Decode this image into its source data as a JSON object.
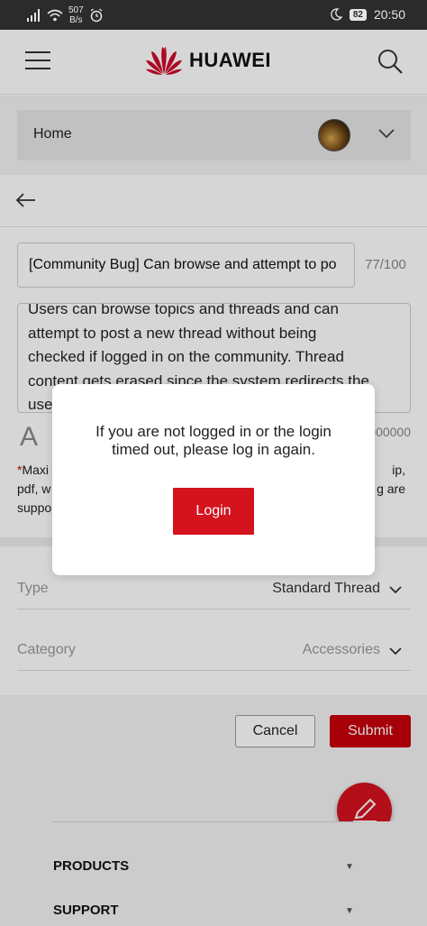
{
  "status_bar": {
    "net_speed_value": "507",
    "net_speed_unit": "B/s",
    "battery": "82",
    "time": "20:50",
    "icons": [
      "signal-icon",
      "wifi-icon",
      "alarm-icon",
      "moon-icon",
      "battery-icon"
    ]
  },
  "header": {
    "brand": "HUAWEI",
    "icons": [
      "hamburger-menu-icon",
      "huawei-logo",
      "search-icon"
    ]
  },
  "breadcrumb": {
    "label": "Home"
  },
  "post": {
    "title_value": "[Community Bug] Can browse and attempt to po",
    "title_count": "77/100",
    "content_lines": [
      "Users can browse topics and threads and can",
      "attempt to post a new thread without being",
      "checked if logged in on the community. Thread",
      "content gets erased since the system redirects the",
      "use"
    ],
    "editor_icon_letter": "A",
    "char_count": "000000",
    "note_lines": [
      "Maxi",
      "pdf, w",
      "suppo"
    ],
    "note_right_lines": [
      "ip,",
      "g are",
      ""
    ]
  },
  "fields": {
    "type_label": "Type",
    "type_value": "Standard Thread",
    "category_label": "Category",
    "category_value": "Accessories"
  },
  "actions": {
    "cancel_label": "Cancel",
    "submit_label": "Submit",
    "fab_icon": "pencil-icon"
  },
  "footer": {
    "items": [
      "PRODUCTS",
      "SUPPORT"
    ]
  },
  "dialog": {
    "message": "If you are not logged in or the login timed out, please log in again.",
    "login_label": "Login"
  },
  "colors": {
    "accent": "#c7000b",
    "status_bar_bg": "#2b2b2b"
  }
}
